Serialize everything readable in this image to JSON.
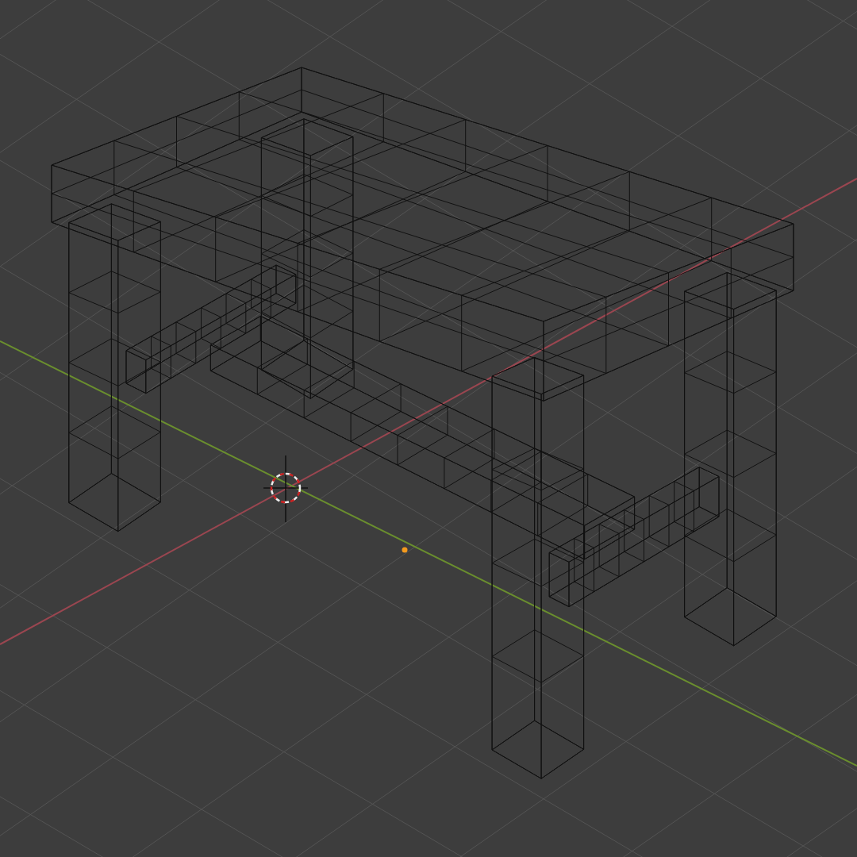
{
  "viewport": {
    "wireframe": true,
    "show_grid": true,
    "show_axes": true
  }
}
